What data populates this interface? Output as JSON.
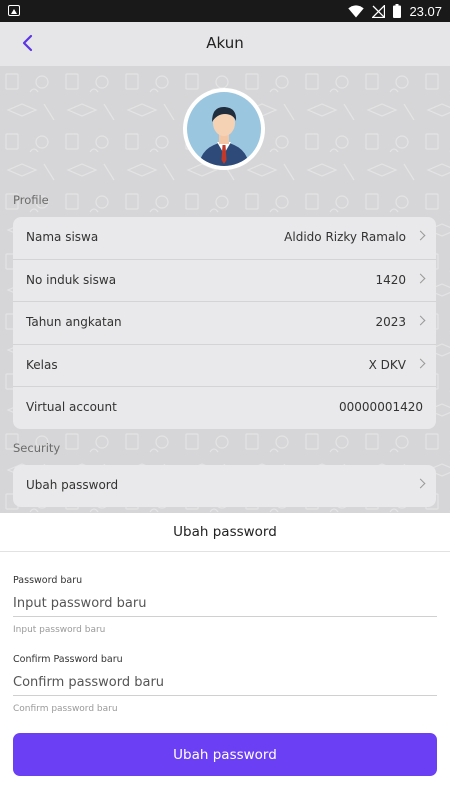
{
  "status_bar": {
    "time": "23.07",
    "icons": [
      "image-icon",
      "wifi-icon",
      "no-signal-icon",
      "battery-icon"
    ]
  },
  "app_bar": {
    "title": "Akun",
    "back_icon": "arrow-back-icon"
  },
  "profile_section": {
    "label": "Profile",
    "rows": [
      {
        "label": "Nama siswa",
        "value": "Aldido Rizky Ramalo",
        "chevron": true
      },
      {
        "label": "No induk siswa",
        "value": "1420",
        "chevron": true
      },
      {
        "label": "Tahun angkatan",
        "value": "2023",
        "chevron": true
      },
      {
        "label": "Kelas",
        "value": "X DKV",
        "chevron": true
      },
      {
        "label": "Virtual account",
        "value": "00000001420",
        "chevron": false
      }
    ]
  },
  "security_section": {
    "label": "Security",
    "rows": [
      {
        "label": "Ubah password"
      }
    ]
  },
  "sheet": {
    "title": "Ubah password",
    "new_password": {
      "label": "Password baru",
      "placeholder": "Input password baru",
      "helper": "Input password baru"
    },
    "confirm_password": {
      "label": "Confirm Password baru",
      "placeholder": "Confirm password baru",
      "helper": "Confirm password baru"
    },
    "submit_label": "Ubah password"
  },
  "colors": {
    "accent": "#6b3ff3",
    "scrim": "#d6d6d8"
  }
}
